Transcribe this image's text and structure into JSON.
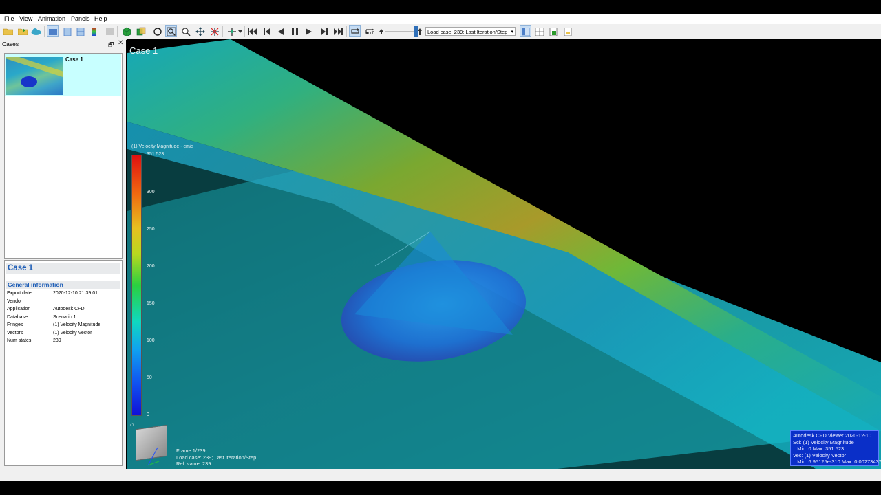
{
  "menu": [
    "File",
    "View",
    "Animation",
    "Panels",
    "Help"
  ],
  "toolbar": {
    "load_case": "Load case: 239; Last Iteration/Step"
  },
  "left_panel": {
    "title": "Cases",
    "case_item_label": "Case 1"
  },
  "info": {
    "title": "Case 1",
    "section": "General information",
    "rows": [
      {
        "k": "Export date",
        "v": "2020-12-10 21:39:01"
      },
      {
        "k": "Vendor",
        "v": ""
      },
      {
        "k": "Application",
        "v": "Autodesk CFD"
      },
      {
        "k": "Database",
        "v": "Scenario 1"
      },
      {
        "k": "Fringes",
        "v": "(1) Velocity Magnitude"
      },
      {
        "k": "Vectors",
        "v": "(1) Velocity Vector"
      },
      {
        "k": "Num states",
        "v": "239"
      }
    ]
  },
  "viewport": {
    "title": "Case 1",
    "legend_title": "(1) Velocity Magnitude - cm/s",
    "legend_ticks": [
      "351.523",
      "300",
      "250",
      "200",
      "150",
      "100",
      "50",
      "0"
    ],
    "frame_lines": [
      "Frame 1/239",
      "Load case: 239; Last Iteration/Step",
      "Ref. value: 239"
    ],
    "status_lines": [
      "Autodesk CFD Viewer  2020-12-10",
      "Scl: (1) Velocity Magnitude",
      "   Min: 0 Max: 351.523",
      "Vec: (1) Velocity Vector",
      "   Min: 6.95125e-310 Max: 0.00273437"
    ]
  },
  "colors": {
    "accent": "#1d5db6",
    "case_selected": "#c8ffff",
    "status_box": "#0a2fc8"
  }
}
